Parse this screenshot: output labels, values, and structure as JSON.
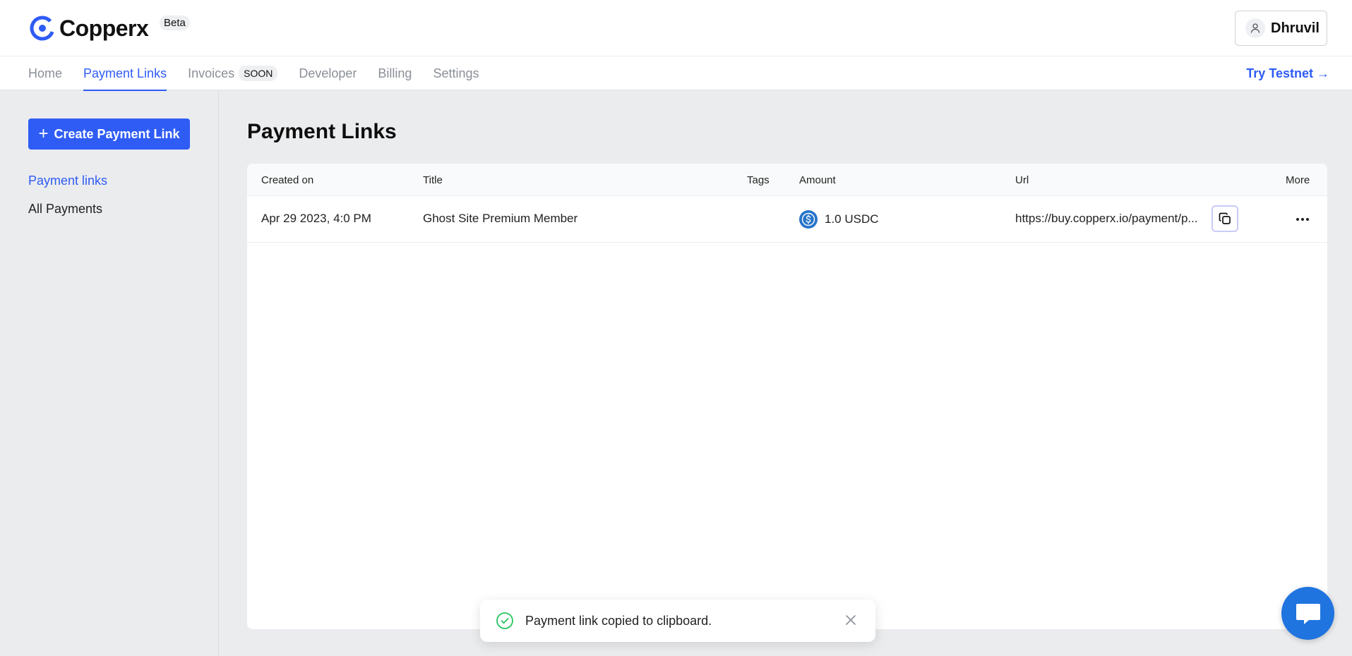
{
  "brand": {
    "name": "Copperx",
    "badge": "Beta",
    "accent": "#2f5cf5"
  },
  "user": {
    "name": "Dhruvil",
    "icon": "user-icon"
  },
  "nav": {
    "items": [
      {
        "label": "Home",
        "active": false
      },
      {
        "label": "Payment Links",
        "active": true
      },
      {
        "label": "Invoices",
        "badge": "SOON",
        "active": false
      },
      {
        "label": "Developer",
        "active": false
      },
      {
        "label": "Billing",
        "active": false
      },
      {
        "label": "Settings",
        "active": false
      }
    ],
    "try_testnet": "Try Testnet →"
  },
  "sidebar": {
    "create_button": "Create Payment Link",
    "links": [
      {
        "label": "Payment links",
        "active": true
      },
      {
        "label": "All Payments",
        "active": false
      }
    ]
  },
  "main": {
    "title": "Payment Links",
    "table": {
      "columns": [
        "Created on",
        "Title",
        "Tags",
        "Amount",
        "Url",
        "More"
      ],
      "rows": [
        {
          "created_on": "Apr 29 2023, 4:0 PM",
          "title": "Ghost Site Premium Member",
          "tags": "",
          "amount": "1.0 USDC",
          "amount_icon": "usdc-icon",
          "url": "https://buy.copperx.io/payment/p..."
        }
      ]
    }
  },
  "toast": {
    "message": "Payment link copied to clipboard.",
    "status_color": "#22c55e"
  },
  "chat": {
    "icon": "chat-bubble-icon",
    "color": "#1f74e0"
  }
}
